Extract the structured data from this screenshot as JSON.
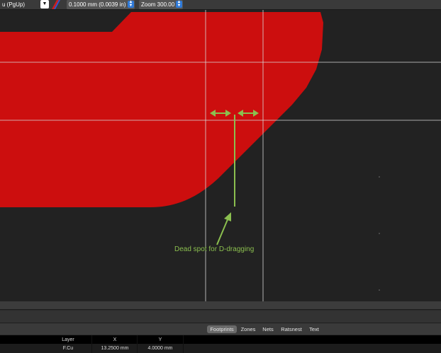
{
  "toolbar": {
    "layer_select_value": "u (PgUp)",
    "grid_select_value": "0.1000 mm (0.0039 in)",
    "zoom_select_value": "Zoom 300.00"
  },
  "canvas": {
    "copper_color": "#cc0e0e",
    "background_color": "#222222",
    "annotation_color": "#8bbf4f",
    "annotation_text": "Dead spot for D-dragging"
  },
  "tabs": [
    {
      "label": "Footprints",
      "active": true
    },
    {
      "label": "Zones",
      "active": false
    },
    {
      "label": "Nets",
      "active": false
    },
    {
      "label": "Ratsnest",
      "active": false
    },
    {
      "label": "Text",
      "active": false
    }
  ],
  "properties": {
    "headers": [
      "Layer",
      "X",
      "Y"
    ],
    "values": [
      "F.Cu",
      "13.2500 mm",
      "4.0000 mm"
    ]
  }
}
